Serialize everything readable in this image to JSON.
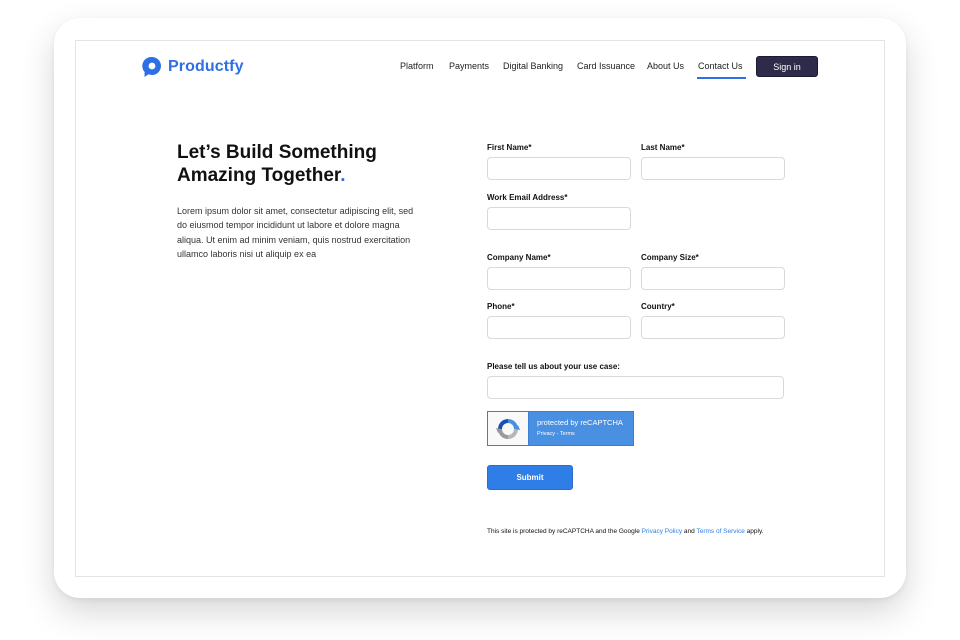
{
  "brand": {
    "name": "Productfy",
    "accent": "#2f6fe4"
  },
  "nav": {
    "items": [
      {
        "label": "Platform"
      },
      {
        "label": "Payments"
      },
      {
        "label": "Digital Banking"
      },
      {
        "label": "Card Issuance"
      },
      {
        "label": "About Us"
      },
      {
        "label": "Contact Us",
        "active": true
      }
    ],
    "signin_label": "Sign in",
    "signin_color": "#2d2a4a"
  },
  "hero": {
    "headline_line1": "Let’s Build Something",
    "headline_line2": "Amazing Together",
    "headline_dot": ".",
    "body": "Lorem ipsum dolor sit amet, consectetur adipiscing elit, sed do eiusmod tempor incididunt ut labore et dolore magna aliqua. Ut enim ad minim veniam, quis nostrud exercitation ullamco laboris nisi ut aliquip ex ea"
  },
  "form": {
    "first_name": {
      "label": "First Name*",
      "value": ""
    },
    "last_name": {
      "label": "Last Name*",
      "value": ""
    },
    "work_email": {
      "label": "Work Email Address*",
      "value": ""
    },
    "company_name": {
      "label": "Company Name*",
      "value": ""
    },
    "company_size": {
      "label": "Company Size*",
      "value": ""
    },
    "phone": {
      "label": "Phone*",
      "value": ""
    },
    "country": {
      "label": "Country*",
      "value": ""
    },
    "use_case": {
      "label": "Please tell us about your use case:",
      "value": ""
    },
    "submit_label": "Submit",
    "submit_color": "#2f7de6"
  },
  "recaptcha": {
    "title": "protected by reCAPTCHA",
    "links": "Privacy - Terms",
    "icon": "recaptcha-icon",
    "color": "#4a90e2"
  },
  "legal": {
    "prefix": "This site is protected by reCAPTCHA and the Google ",
    "privacy_link": "Privacy Policy",
    "and": " and ",
    "terms_link": "Terms of Service",
    "suffix": " apply."
  }
}
